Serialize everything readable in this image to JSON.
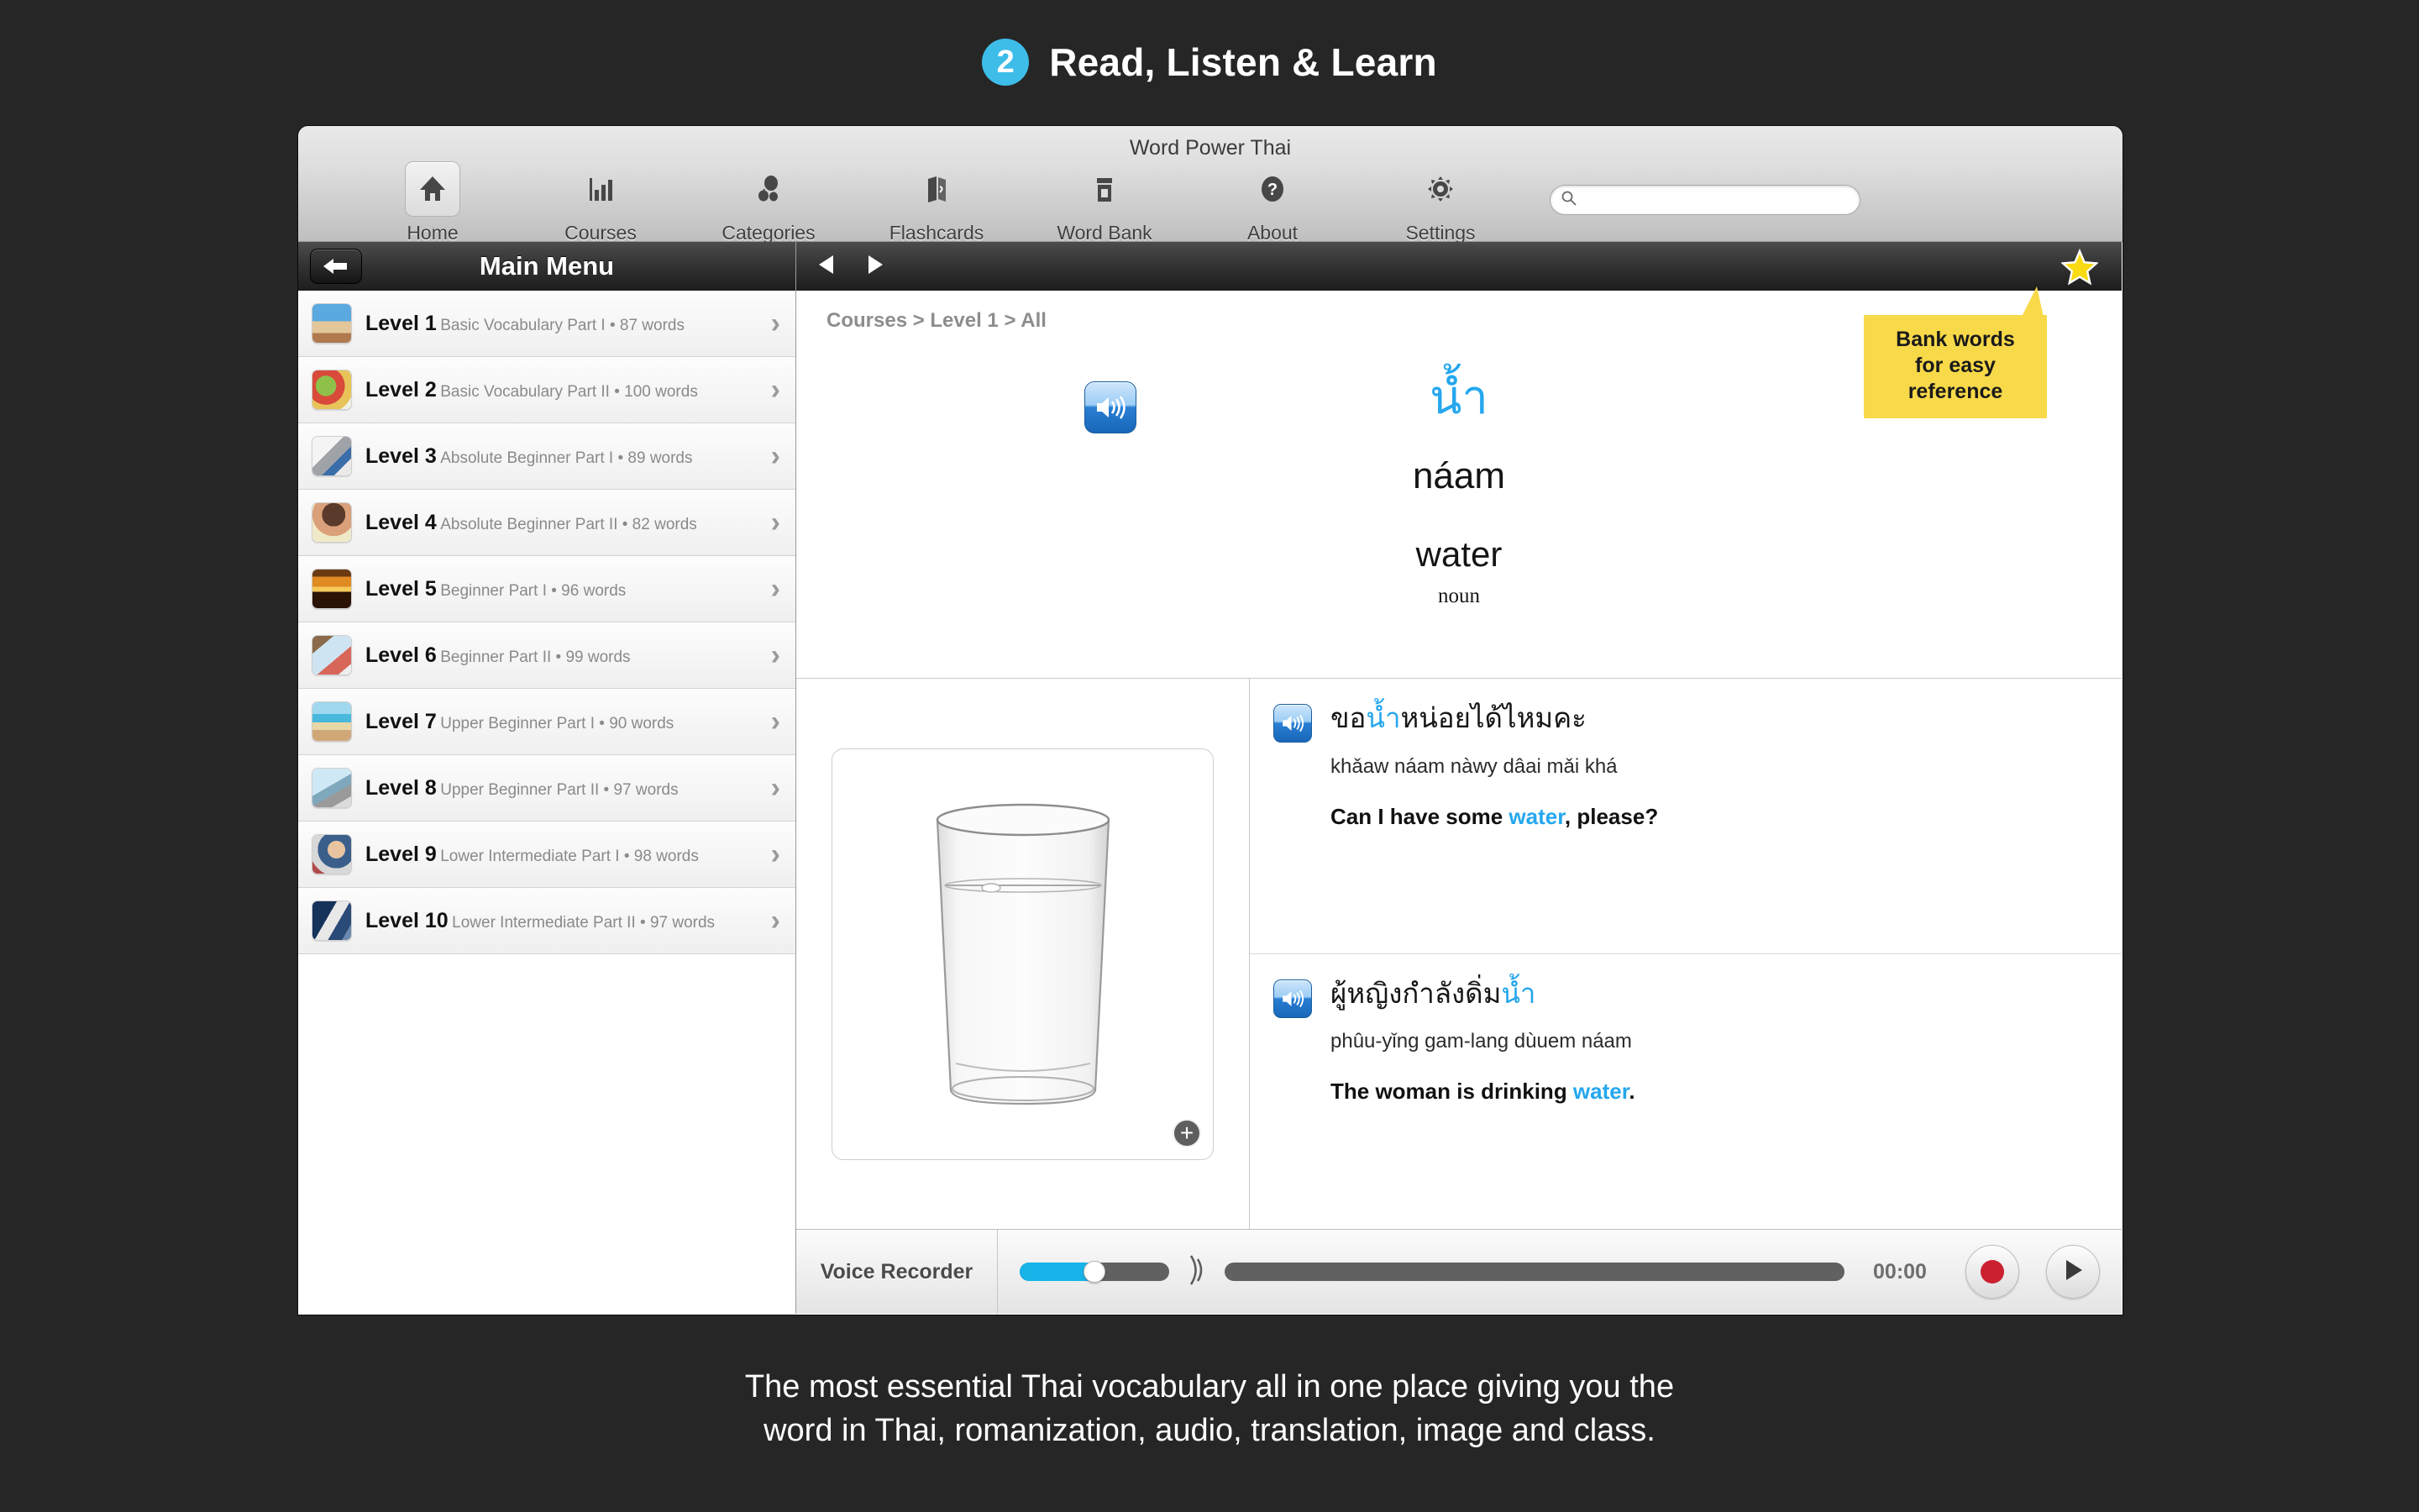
{
  "promo": {
    "step_number": "2",
    "step_title": "Read, Listen & Learn",
    "badge_color": "#3dbde8",
    "caption_line1": "The most essential Thai vocabulary all in one place giving you the",
    "caption_line2": "word in Thai, romanization, audio, translation, image and class."
  },
  "window": {
    "title": "Word Power Thai"
  },
  "toolbar": {
    "items": [
      {
        "label": "Home",
        "icon": "home-icon",
        "active": true
      },
      {
        "label": "Courses",
        "icon": "bar-chart-icon",
        "active": false
      },
      {
        "label": "Categories",
        "icon": "categories-icon",
        "active": false
      },
      {
        "label": "Flashcards",
        "icon": "flashcards-icon",
        "active": false
      },
      {
        "label": "Word Bank",
        "icon": "wordbank-icon",
        "active": false
      },
      {
        "label": "About",
        "icon": "question-mark-icon",
        "active": false
      },
      {
        "label": "Settings",
        "icon": "gear-icon",
        "active": false
      }
    ],
    "search": {
      "value": "",
      "placeholder": ""
    }
  },
  "sidebar": {
    "header_title": "Main Menu",
    "back_label": "",
    "items": [
      {
        "title": "Level 1",
        "subtitle": "Basic Vocabulary Part I • 87 words",
        "thumb": "hurdle-runner-photo"
      },
      {
        "title": "Level 2",
        "subtitle": "Basic Vocabulary Part II • 100 words",
        "thumb": "vegetables-photo"
      },
      {
        "title": "Level 3",
        "subtitle": "Absolute Beginner Part I • 89 words",
        "thumb": "keys-photo"
      },
      {
        "title": "Level 4",
        "subtitle": "Absolute Beginner Part II • 82 words",
        "thumb": "toothbrush-woman-photo"
      },
      {
        "title": "Level 5",
        "subtitle": "Beginner Part I • 96 words",
        "thumb": "sunset-photo"
      },
      {
        "title": "Level 6",
        "subtitle": "Beginner Part II • 99 words",
        "thumb": "bed-photo"
      },
      {
        "title": "Level 7",
        "subtitle": "Upper Beginner Part I • 90 words",
        "thumb": "beach-hammock-photo"
      },
      {
        "title": "Level 8",
        "subtitle": "Upper Beginner Part II • 97 words",
        "thumb": "laptop-photo"
      },
      {
        "title": "Level 9",
        "subtitle": "Lower Intermediate Part I • 98 words",
        "thumb": "man-classroom-photo"
      },
      {
        "title": "Level 10",
        "subtitle": "Lower Intermediate Part II • 97 words",
        "thumb": "runner-track-photo"
      }
    ]
  },
  "content": {
    "breadcrumb": "Courses > Level 1 > All",
    "nav": {
      "prev": "◀",
      "next": "▶",
      "star": "star-icon"
    },
    "callout": {
      "line1": "Bank words",
      "line2": "for easy",
      "line3": "reference"
    },
    "word": {
      "native": "น้ำ",
      "romanization": "náam",
      "translation": "water",
      "word_class": "noun",
      "native_color": "#25a7ee",
      "audio_button": "speaker-icon"
    },
    "image": {
      "alt": "glass-of-water-photo",
      "zoom_label": "+"
    },
    "examples": [
      {
        "native_prefix": "ขอ",
        "native_highlight": "น้ำ",
        "native_suffix": "หน่อยได้ไหมคะ",
        "romanization": "khǎaw náam nàwy dâai mǎi khá",
        "english_prefix": "Can I have some ",
        "english_highlight": "water",
        "english_suffix": ", please?"
      },
      {
        "native_prefix": "ผู้หญิงกำลังดิ่ม",
        "native_highlight": "น้ำ",
        "native_suffix": "",
        "romanization": "phûu-yǐng gam-lang dùuem náam",
        "english_prefix": "The woman is drinking ",
        "english_highlight": "water",
        "english_suffix": "."
      }
    ],
    "recorder": {
      "label": "Voice Recorder",
      "volume_percent": 50,
      "progress_percent": 0,
      "time": "00:00",
      "record_button": "record-icon",
      "play_button": "play-icon"
    }
  },
  "colors": {
    "accent_blue": "#25a7ee",
    "callout_yellow": "#f8d949",
    "record_red": "#cb2030",
    "page_background": "#272626"
  }
}
